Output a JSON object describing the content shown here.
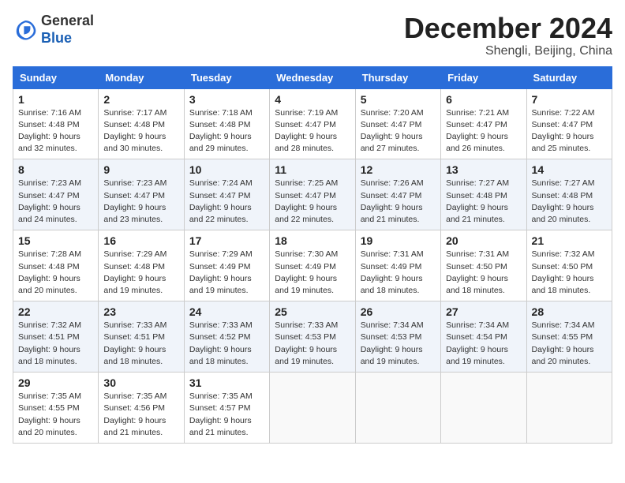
{
  "logo": {
    "text_general": "General",
    "text_blue": "Blue"
  },
  "title": {
    "month_year": "December 2024",
    "location": "Shengli, Beijing, China"
  },
  "days_of_week": [
    "Sunday",
    "Monday",
    "Tuesday",
    "Wednesday",
    "Thursday",
    "Friday",
    "Saturday"
  ],
  "weeks": [
    [
      {
        "day": "1",
        "sunrise": "Sunrise: 7:16 AM",
        "sunset": "Sunset: 4:48 PM",
        "daylight": "Daylight: 9 hours and 32 minutes."
      },
      {
        "day": "2",
        "sunrise": "Sunrise: 7:17 AM",
        "sunset": "Sunset: 4:48 PM",
        "daylight": "Daylight: 9 hours and 30 minutes."
      },
      {
        "day": "3",
        "sunrise": "Sunrise: 7:18 AM",
        "sunset": "Sunset: 4:48 PM",
        "daylight": "Daylight: 9 hours and 29 minutes."
      },
      {
        "day": "4",
        "sunrise": "Sunrise: 7:19 AM",
        "sunset": "Sunset: 4:47 PM",
        "daylight": "Daylight: 9 hours and 28 minutes."
      },
      {
        "day": "5",
        "sunrise": "Sunrise: 7:20 AM",
        "sunset": "Sunset: 4:47 PM",
        "daylight": "Daylight: 9 hours and 27 minutes."
      },
      {
        "day": "6",
        "sunrise": "Sunrise: 7:21 AM",
        "sunset": "Sunset: 4:47 PM",
        "daylight": "Daylight: 9 hours and 26 minutes."
      },
      {
        "day": "7",
        "sunrise": "Sunrise: 7:22 AM",
        "sunset": "Sunset: 4:47 PM",
        "daylight": "Daylight: 9 hours and 25 minutes."
      }
    ],
    [
      {
        "day": "8",
        "sunrise": "Sunrise: 7:23 AM",
        "sunset": "Sunset: 4:47 PM",
        "daylight": "Daylight: 9 hours and 24 minutes."
      },
      {
        "day": "9",
        "sunrise": "Sunrise: 7:23 AM",
        "sunset": "Sunset: 4:47 PM",
        "daylight": "Daylight: 9 hours and 23 minutes."
      },
      {
        "day": "10",
        "sunrise": "Sunrise: 7:24 AM",
        "sunset": "Sunset: 4:47 PM",
        "daylight": "Daylight: 9 hours and 22 minutes."
      },
      {
        "day": "11",
        "sunrise": "Sunrise: 7:25 AM",
        "sunset": "Sunset: 4:47 PM",
        "daylight": "Daylight: 9 hours and 22 minutes."
      },
      {
        "day": "12",
        "sunrise": "Sunrise: 7:26 AM",
        "sunset": "Sunset: 4:47 PM",
        "daylight": "Daylight: 9 hours and 21 minutes."
      },
      {
        "day": "13",
        "sunrise": "Sunrise: 7:27 AM",
        "sunset": "Sunset: 4:48 PM",
        "daylight": "Daylight: 9 hours and 21 minutes."
      },
      {
        "day": "14",
        "sunrise": "Sunrise: 7:27 AM",
        "sunset": "Sunset: 4:48 PM",
        "daylight": "Daylight: 9 hours and 20 minutes."
      }
    ],
    [
      {
        "day": "15",
        "sunrise": "Sunrise: 7:28 AM",
        "sunset": "Sunset: 4:48 PM",
        "daylight": "Daylight: 9 hours and 20 minutes."
      },
      {
        "day": "16",
        "sunrise": "Sunrise: 7:29 AM",
        "sunset": "Sunset: 4:48 PM",
        "daylight": "Daylight: 9 hours and 19 minutes."
      },
      {
        "day": "17",
        "sunrise": "Sunrise: 7:29 AM",
        "sunset": "Sunset: 4:49 PM",
        "daylight": "Daylight: 9 hours and 19 minutes."
      },
      {
        "day": "18",
        "sunrise": "Sunrise: 7:30 AM",
        "sunset": "Sunset: 4:49 PM",
        "daylight": "Daylight: 9 hours and 19 minutes."
      },
      {
        "day": "19",
        "sunrise": "Sunrise: 7:31 AM",
        "sunset": "Sunset: 4:49 PM",
        "daylight": "Daylight: 9 hours and 18 minutes."
      },
      {
        "day": "20",
        "sunrise": "Sunrise: 7:31 AM",
        "sunset": "Sunset: 4:50 PM",
        "daylight": "Daylight: 9 hours and 18 minutes."
      },
      {
        "day": "21",
        "sunrise": "Sunrise: 7:32 AM",
        "sunset": "Sunset: 4:50 PM",
        "daylight": "Daylight: 9 hours and 18 minutes."
      }
    ],
    [
      {
        "day": "22",
        "sunrise": "Sunrise: 7:32 AM",
        "sunset": "Sunset: 4:51 PM",
        "daylight": "Daylight: 9 hours and 18 minutes."
      },
      {
        "day": "23",
        "sunrise": "Sunrise: 7:33 AM",
        "sunset": "Sunset: 4:51 PM",
        "daylight": "Daylight: 9 hours and 18 minutes."
      },
      {
        "day": "24",
        "sunrise": "Sunrise: 7:33 AM",
        "sunset": "Sunset: 4:52 PM",
        "daylight": "Daylight: 9 hours and 18 minutes."
      },
      {
        "day": "25",
        "sunrise": "Sunrise: 7:33 AM",
        "sunset": "Sunset: 4:53 PM",
        "daylight": "Daylight: 9 hours and 19 minutes."
      },
      {
        "day": "26",
        "sunrise": "Sunrise: 7:34 AM",
        "sunset": "Sunset: 4:53 PM",
        "daylight": "Daylight: 9 hours and 19 minutes."
      },
      {
        "day": "27",
        "sunrise": "Sunrise: 7:34 AM",
        "sunset": "Sunset: 4:54 PM",
        "daylight": "Daylight: 9 hours and 19 minutes."
      },
      {
        "day": "28",
        "sunrise": "Sunrise: 7:34 AM",
        "sunset": "Sunset: 4:55 PM",
        "daylight": "Daylight: 9 hours and 20 minutes."
      }
    ],
    [
      {
        "day": "29",
        "sunrise": "Sunrise: 7:35 AM",
        "sunset": "Sunset: 4:55 PM",
        "daylight": "Daylight: 9 hours and 20 minutes."
      },
      {
        "day": "30",
        "sunrise": "Sunrise: 7:35 AM",
        "sunset": "Sunset: 4:56 PM",
        "daylight": "Daylight: 9 hours and 21 minutes."
      },
      {
        "day": "31",
        "sunrise": "Sunrise: 7:35 AM",
        "sunset": "Sunset: 4:57 PM",
        "daylight": "Daylight: 9 hours and 21 minutes."
      },
      null,
      null,
      null,
      null
    ]
  ]
}
